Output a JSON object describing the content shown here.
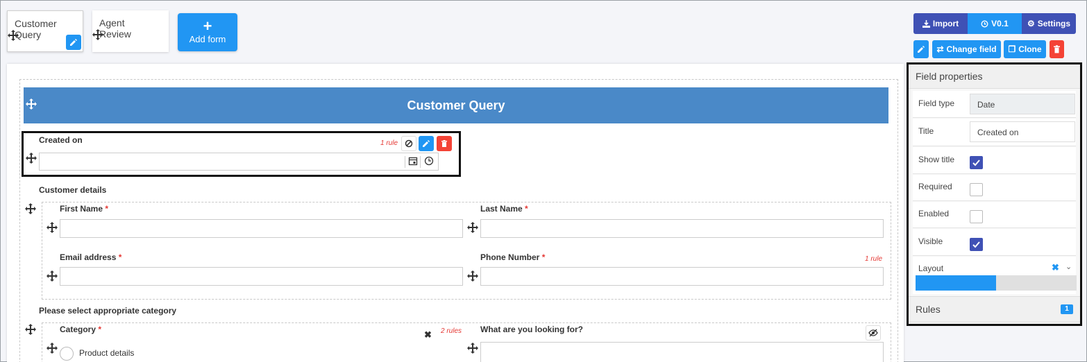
{
  "tabs": [
    {
      "label": "Customer Query",
      "active": true
    },
    {
      "label": "Agent Review",
      "active": false
    }
  ],
  "add_form_label": "Add form",
  "toolbar": {
    "import_label": "Import",
    "version_label": "V0.1",
    "settings_label": "Settings",
    "change_field_label": "Change field",
    "clone_label": "Clone"
  },
  "form": {
    "title": "Customer Query",
    "created_on": {
      "label": "Created on",
      "rule_note": "1 rule",
      "value": ""
    },
    "customer_details": {
      "section_label": "Customer details",
      "first_name": "First Name",
      "last_name": "Last Name",
      "email": "Email address",
      "phone": "Phone Number",
      "phone_rule_note": "1 rule",
      "required_mark": "*"
    },
    "category_section": {
      "section_label": "Please select appropriate category",
      "category_label": "Category",
      "category_rule_note": "2 rules",
      "option_1": "Product details",
      "looking_for_label": "What are you looking for?"
    }
  },
  "properties": {
    "header": "Field properties",
    "field_type_label": "Field type",
    "field_type_value": "Date",
    "title_label": "Title",
    "title_value": "Created on",
    "show_title_label": "Show title",
    "show_title": true,
    "required_label": "Required",
    "required": false,
    "enabled_label": "Enabled",
    "enabled": false,
    "visible_label": "Visible",
    "visible": true,
    "layout_label": "Layout",
    "layout_fraction": 0.5,
    "rules_label": "Rules",
    "rules_count": "1"
  },
  "colors": {
    "primary": "#2196f3",
    "indigo": "#3f51b5",
    "danger": "#f44336",
    "banner": "#4a89c8"
  }
}
